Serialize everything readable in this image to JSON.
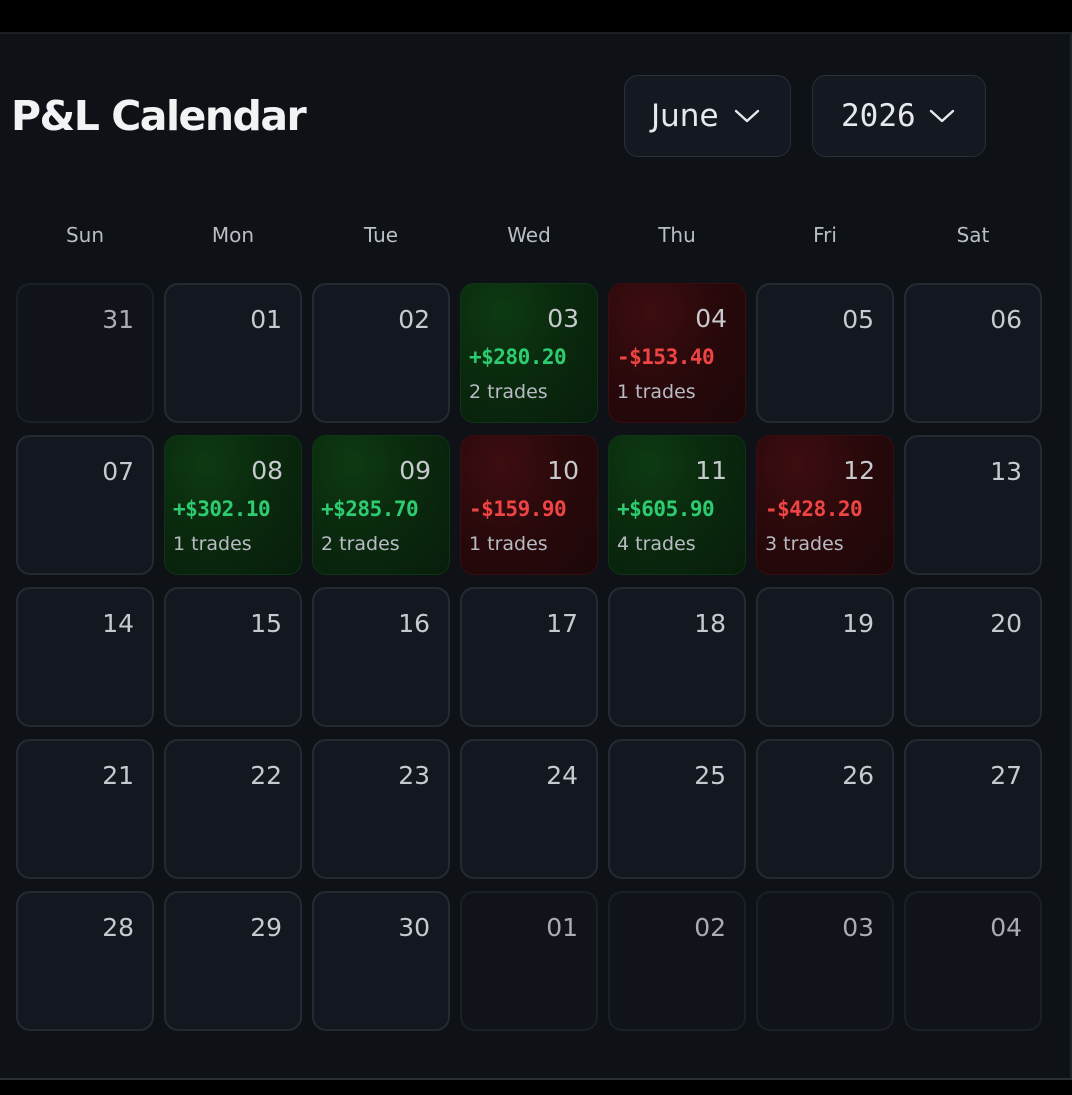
{
  "title": "P&L Calendar",
  "month_select": {
    "value": "June"
  },
  "year_select": {
    "value": "2026"
  },
  "weekdays": [
    "Sun",
    "Mon",
    "Tue",
    "Wed",
    "Thu",
    "Fri",
    "Sat"
  ],
  "colors": {
    "profit": "#2ecc71",
    "loss": "#ef4444",
    "background": "#0e1116"
  },
  "weeks": [
    [
      {
        "day": "31",
        "in_month": false
      },
      {
        "day": "01",
        "in_month": true
      },
      {
        "day": "02",
        "in_month": true
      },
      {
        "day": "03",
        "in_month": true,
        "pnl": "+$280.20",
        "trades": "2 trades",
        "status": "pos"
      },
      {
        "day": "04",
        "in_month": true,
        "pnl": "-$153.40",
        "trades": "1 trades",
        "status": "neg"
      },
      {
        "day": "05",
        "in_month": true
      },
      {
        "day": "06",
        "in_month": true
      }
    ],
    [
      {
        "day": "07",
        "in_month": true
      },
      {
        "day": "08",
        "in_month": true,
        "pnl": "+$302.10",
        "trades": "1 trades",
        "status": "pos"
      },
      {
        "day": "09",
        "in_month": true,
        "pnl": "+$285.70",
        "trades": "2 trades",
        "status": "pos"
      },
      {
        "day": "10",
        "in_month": true,
        "pnl": "-$159.90",
        "trades": "1 trades",
        "status": "neg"
      },
      {
        "day": "11",
        "in_month": true,
        "pnl": "+$605.90",
        "trades": "4 trades",
        "status": "pos"
      },
      {
        "day": "12",
        "in_month": true,
        "pnl": "-$428.20",
        "trades": "3 trades",
        "status": "neg"
      },
      {
        "day": "13",
        "in_month": true
      }
    ],
    [
      {
        "day": "14",
        "in_month": true
      },
      {
        "day": "15",
        "in_month": true
      },
      {
        "day": "16",
        "in_month": true
      },
      {
        "day": "17",
        "in_month": true
      },
      {
        "day": "18",
        "in_month": true
      },
      {
        "day": "19",
        "in_month": true
      },
      {
        "day": "20",
        "in_month": true
      }
    ],
    [
      {
        "day": "21",
        "in_month": true
      },
      {
        "day": "22",
        "in_month": true
      },
      {
        "day": "23",
        "in_month": true
      },
      {
        "day": "24",
        "in_month": true
      },
      {
        "day": "25",
        "in_month": true
      },
      {
        "day": "26",
        "in_month": true
      },
      {
        "day": "27",
        "in_month": true
      }
    ],
    [
      {
        "day": "28",
        "in_month": true
      },
      {
        "day": "29",
        "in_month": true
      },
      {
        "day": "30",
        "in_month": true
      },
      {
        "day": "01",
        "in_month": false
      },
      {
        "day": "02",
        "in_month": false
      },
      {
        "day": "03",
        "in_month": false
      },
      {
        "day": "04",
        "in_month": false
      }
    ]
  ]
}
